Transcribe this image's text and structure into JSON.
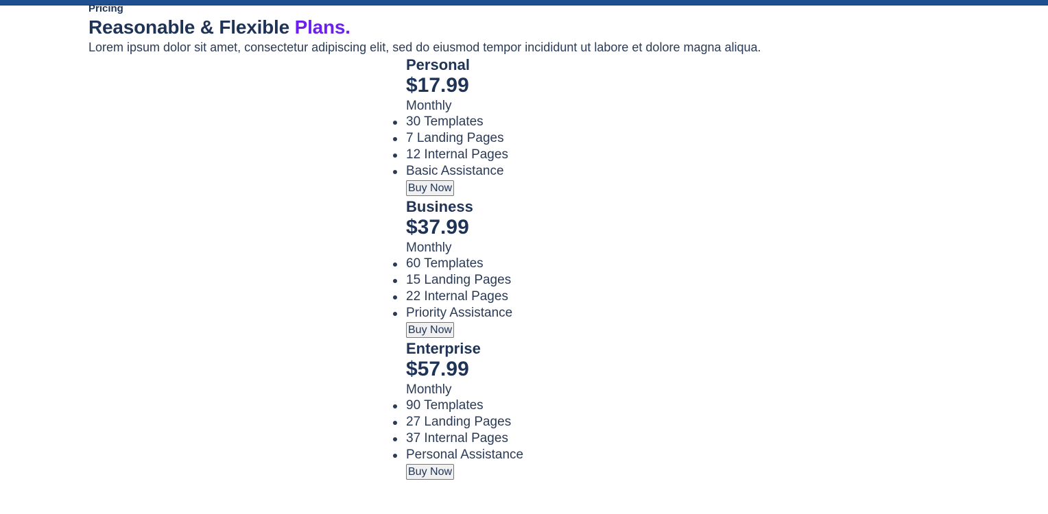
{
  "header": {
    "eyebrow": "Pricing",
    "title_main": "Reasonable & Flexible ",
    "title_accent": "Plans.",
    "subtitle": "Lorem ipsum dolor sit amet, consectetur adipiscing elit, sed do eiusmod tempor incididunt ut labore et dolore magna aliqua."
  },
  "colors": {
    "top_bar": "#1d4f91",
    "text": "#1e3356",
    "accent": "#6d1ef0"
  },
  "plans": [
    {
      "name": "Personal",
      "price": "$17.99",
      "period": "Monthly",
      "features": [
        "30 Templates",
        "7 Landing Pages",
        "12 Internal Pages",
        "Basic Assistance"
      ],
      "button": "Buy Now"
    },
    {
      "name": "Business",
      "price": "$37.99",
      "period": "Monthly",
      "features": [
        "60 Templates",
        "15 Landing Pages",
        "22 Internal Pages",
        "Priority Assistance"
      ],
      "button": "Buy Now"
    },
    {
      "name": "Enterprise",
      "price": "$57.99",
      "period": "Monthly",
      "features": [
        "90 Templates",
        "27 Landing Pages",
        "37 Internal Pages",
        "Personal Assistance"
      ],
      "button": "Buy Now"
    }
  ]
}
